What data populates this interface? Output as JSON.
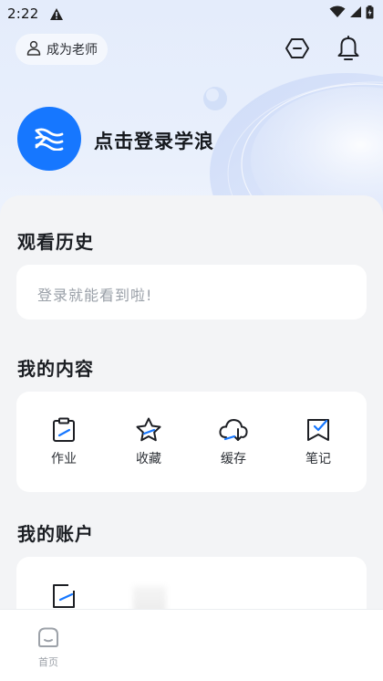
{
  "status_bar": {
    "time": "2:22",
    "icons": [
      "alert-icon",
      "wifi-icon",
      "signal-icon",
      "battery-icon"
    ]
  },
  "header": {
    "teacher_button_label": "成为老师",
    "icons": [
      "hexagon-minus-icon",
      "bell-icon"
    ]
  },
  "profile": {
    "login_prompt": "点击登录学浪",
    "avatar_icon": "xuelang-logo-icon"
  },
  "history": {
    "title": "观看历史",
    "placeholder": "登录就能看到啦!"
  },
  "my_content": {
    "title": "我的内容",
    "items": [
      {
        "label": "作业",
        "icon": "clipboard-icon"
      },
      {
        "label": "收藏",
        "icon": "star-icon"
      },
      {
        "label": "缓存",
        "icon": "cloud-download-icon"
      },
      {
        "label": "笔记",
        "icon": "note-check-icon"
      }
    ]
  },
  "my_account": {
    "title": "我的账户",
    "items": [
      {
        "label": "",
        "icon": "edit-square-icon"
      }
    ]
  },
  "tabbar": {
    "items": [
      {
        "label": "首页",
        "icon": "home-tab-icon"
      }
    ]
  },
  "colors": {
    "accent": "#1677ff",
    "hero_bg": "#e4ecfb",
    "page_bg": "#f3f4f6"
  }
}
